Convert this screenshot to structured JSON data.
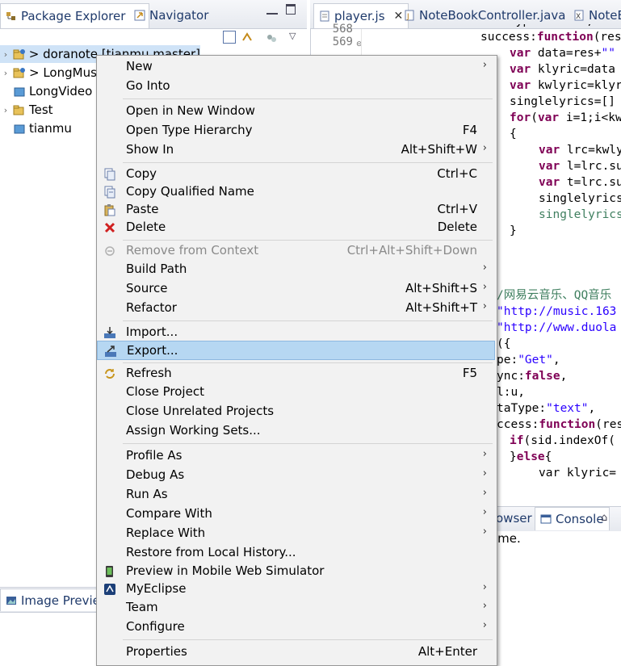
{
  "left_panel": {
    "tabs": [
      {
        "label": "Package Explorer",
        "close": "✕"
      },
      {
        "label": "Navigator"
      }
    ],
    "tree": [
      {
        "label": "> doranote [tianmu master]",
        "expand": "›"
      },
      {
        "label": "> LongMusic",
        "expand": "›"
      },
      {
        "label": "LongVideo",
        "expand": ""
      },
      {
        "label": "Test",
        "expand": "›"
      },
      {
        "label": "tianmu",
        "expand": ""
      }
    ],
    "bottom_tab": "Image Preview"
  },
  "editor": {
    "tabs": [
      {
        "label": "player.js",
        "close": "✕"
      },
      {
        "label": "NoteBookController.java"
      },
      {
        "label": "NoteB"
      }
    ],
    "line_numbers": [
      "568",
      "569"
    ],
    "console_tabs": [
      "owser",
      "Console"
    ],
    "console_text": "ime."
  },
  "menu": {
    "items": [
      {
        "label": "New",
        "shortcut": "",
        "submenu": true
      },
      {
        "label": "Go Into",
        "shortcut": ""
      },
      {
        "label": "Open in New Window",
        "shortcut": ""
      },
      {
        "label": "Open Type Hierarchy",
        "shortcut": "F4"
      },
      {
        "label": "Show In",
        "shortcut": "Alt+Shift+W",
        "submenu": true
      },
      {
        "label": "Copy",
        "shortcut": "Ctrl+C"
      },
      {
        "label": "Copy Qualified Name",
        "shortcut": ""
      },
      {
        "label": "Paste",
        "shortcut": "Ctrl+V"
      },
      {
        "label": "Delete",
        "shortcut": "Delete"
      },
      {
        "label": "Remove from Context",
        "shortcut": "Ctrl+Alt+Shift+Down",
        "disabled": true
      },
      {
        "label": "Build Path",
        "shortcut": "",
        "submenu": true
      },
      {
        "label": "Source",
        "shortcut": "Alt+Shift+S",
        "submenu": true
      },
      {
        "label": "Refactor",
        "shortcut": "Alt+Shift+T",
        "submenu": true
      },
      {
        "label": "Import...",
        "shortcut": ""
      },
      {
        "label": "Export...",
        "shortcut": "",
        "highlighted": true
      },
      {
        "label": "Refresh",
        "shortcut": "F5"
      },
      {
        "label": "Close Project",
        "shortcut": ""
      },
      {
        "label": "Close Unrelated Projects",
        "shortcut": ""
      },
      {
        "label": "Assign Working Sets...",
        "shortcut": ""
      },
      {
        "label": "Profile As",
        "shortcut": "",
        "submenu": true
      },
      {
        "label": "Debug As",
        "shortcut": "",
        "submenu": true
      },
      {
        "label": "Run As",
        "shortcut": "",
        "submenu": true
      },
      {
        "label": "Compare With",
        "shortcut": "",
        "submenu": true
      },
      {
        "label": "Replace With",
        "shortcut": "",
        "submenu": true
      },
      {
        "label": "Restore from Local History...",
        "shortcut": ""
      },
      {
        "label": "Preview in Mobile Web Simulator",
        "shortcut": ""
      },
      {
        "label": "MyEclipse",
        "shortcut": "",
        "submenu": true
      },
      {
        "label": "Team",
        "shortcut": "",
        "submenu": true
      },
      {
        "label": "Configure",
        "shortcut": "",
        "submenu": true
      },
      {
        "label": "Properties",
        "shortcut": "Alt+Enter"
      }
    ],
    "submenu_glyph": "›"
  },
  "colors": {
    "menu_highlight": "#b6d7f2",
    "keyword": "#7f0055",
    "string": "#2a00ff",
    "delete_icon": "#d02020"
  }
}
